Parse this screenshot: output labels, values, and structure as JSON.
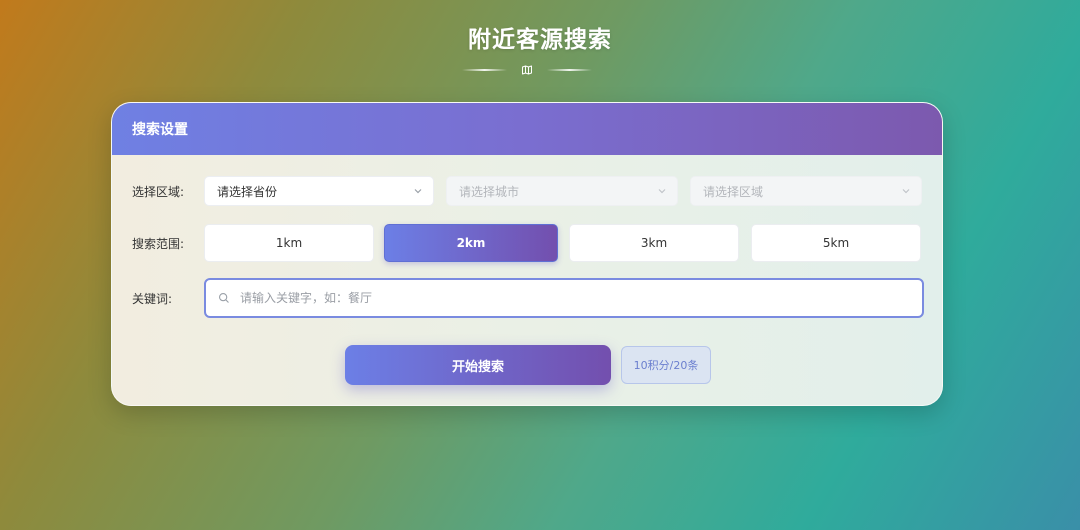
{
  "page": {
    "title": "附近客源搜索"
  },
  "card": {
    "header_title": "搜索设置"
  },
  "region": {
    "label": "选择区域:",
    "province": {
      "value": "请选择省份"
    },
    "city": {
      "placeholder": "请选择城市"
    },
    "district": {
      "placeholder": "请选择区域"
    }
  },
  "range": {
    "label": "搜索范围:",
    "options": [
      "1km",
      "2km",
      "3km",
      "5km"
    ],
    "selected": "2km"
  },
  "keyword": {
    "label": "关键词:",
    "placeholder": "请输入关键字，如：餐厅",
    "value": ""
  },
  "actions": {
    "start_label": "开始搜索",
    "cost_label": "10积分/20条"
  },
  "colors": {
    "accent_start": "#6c7fe6",
    "accent_end": "#734fae",
    "header_start": "#6f80e3",
    "header_end": "#7c59ae"
  },
  "icons": {
    "divider": "map-icon",
    "select": "chevron-down-icon",
    "keyword": "search-icon"
  }
}
